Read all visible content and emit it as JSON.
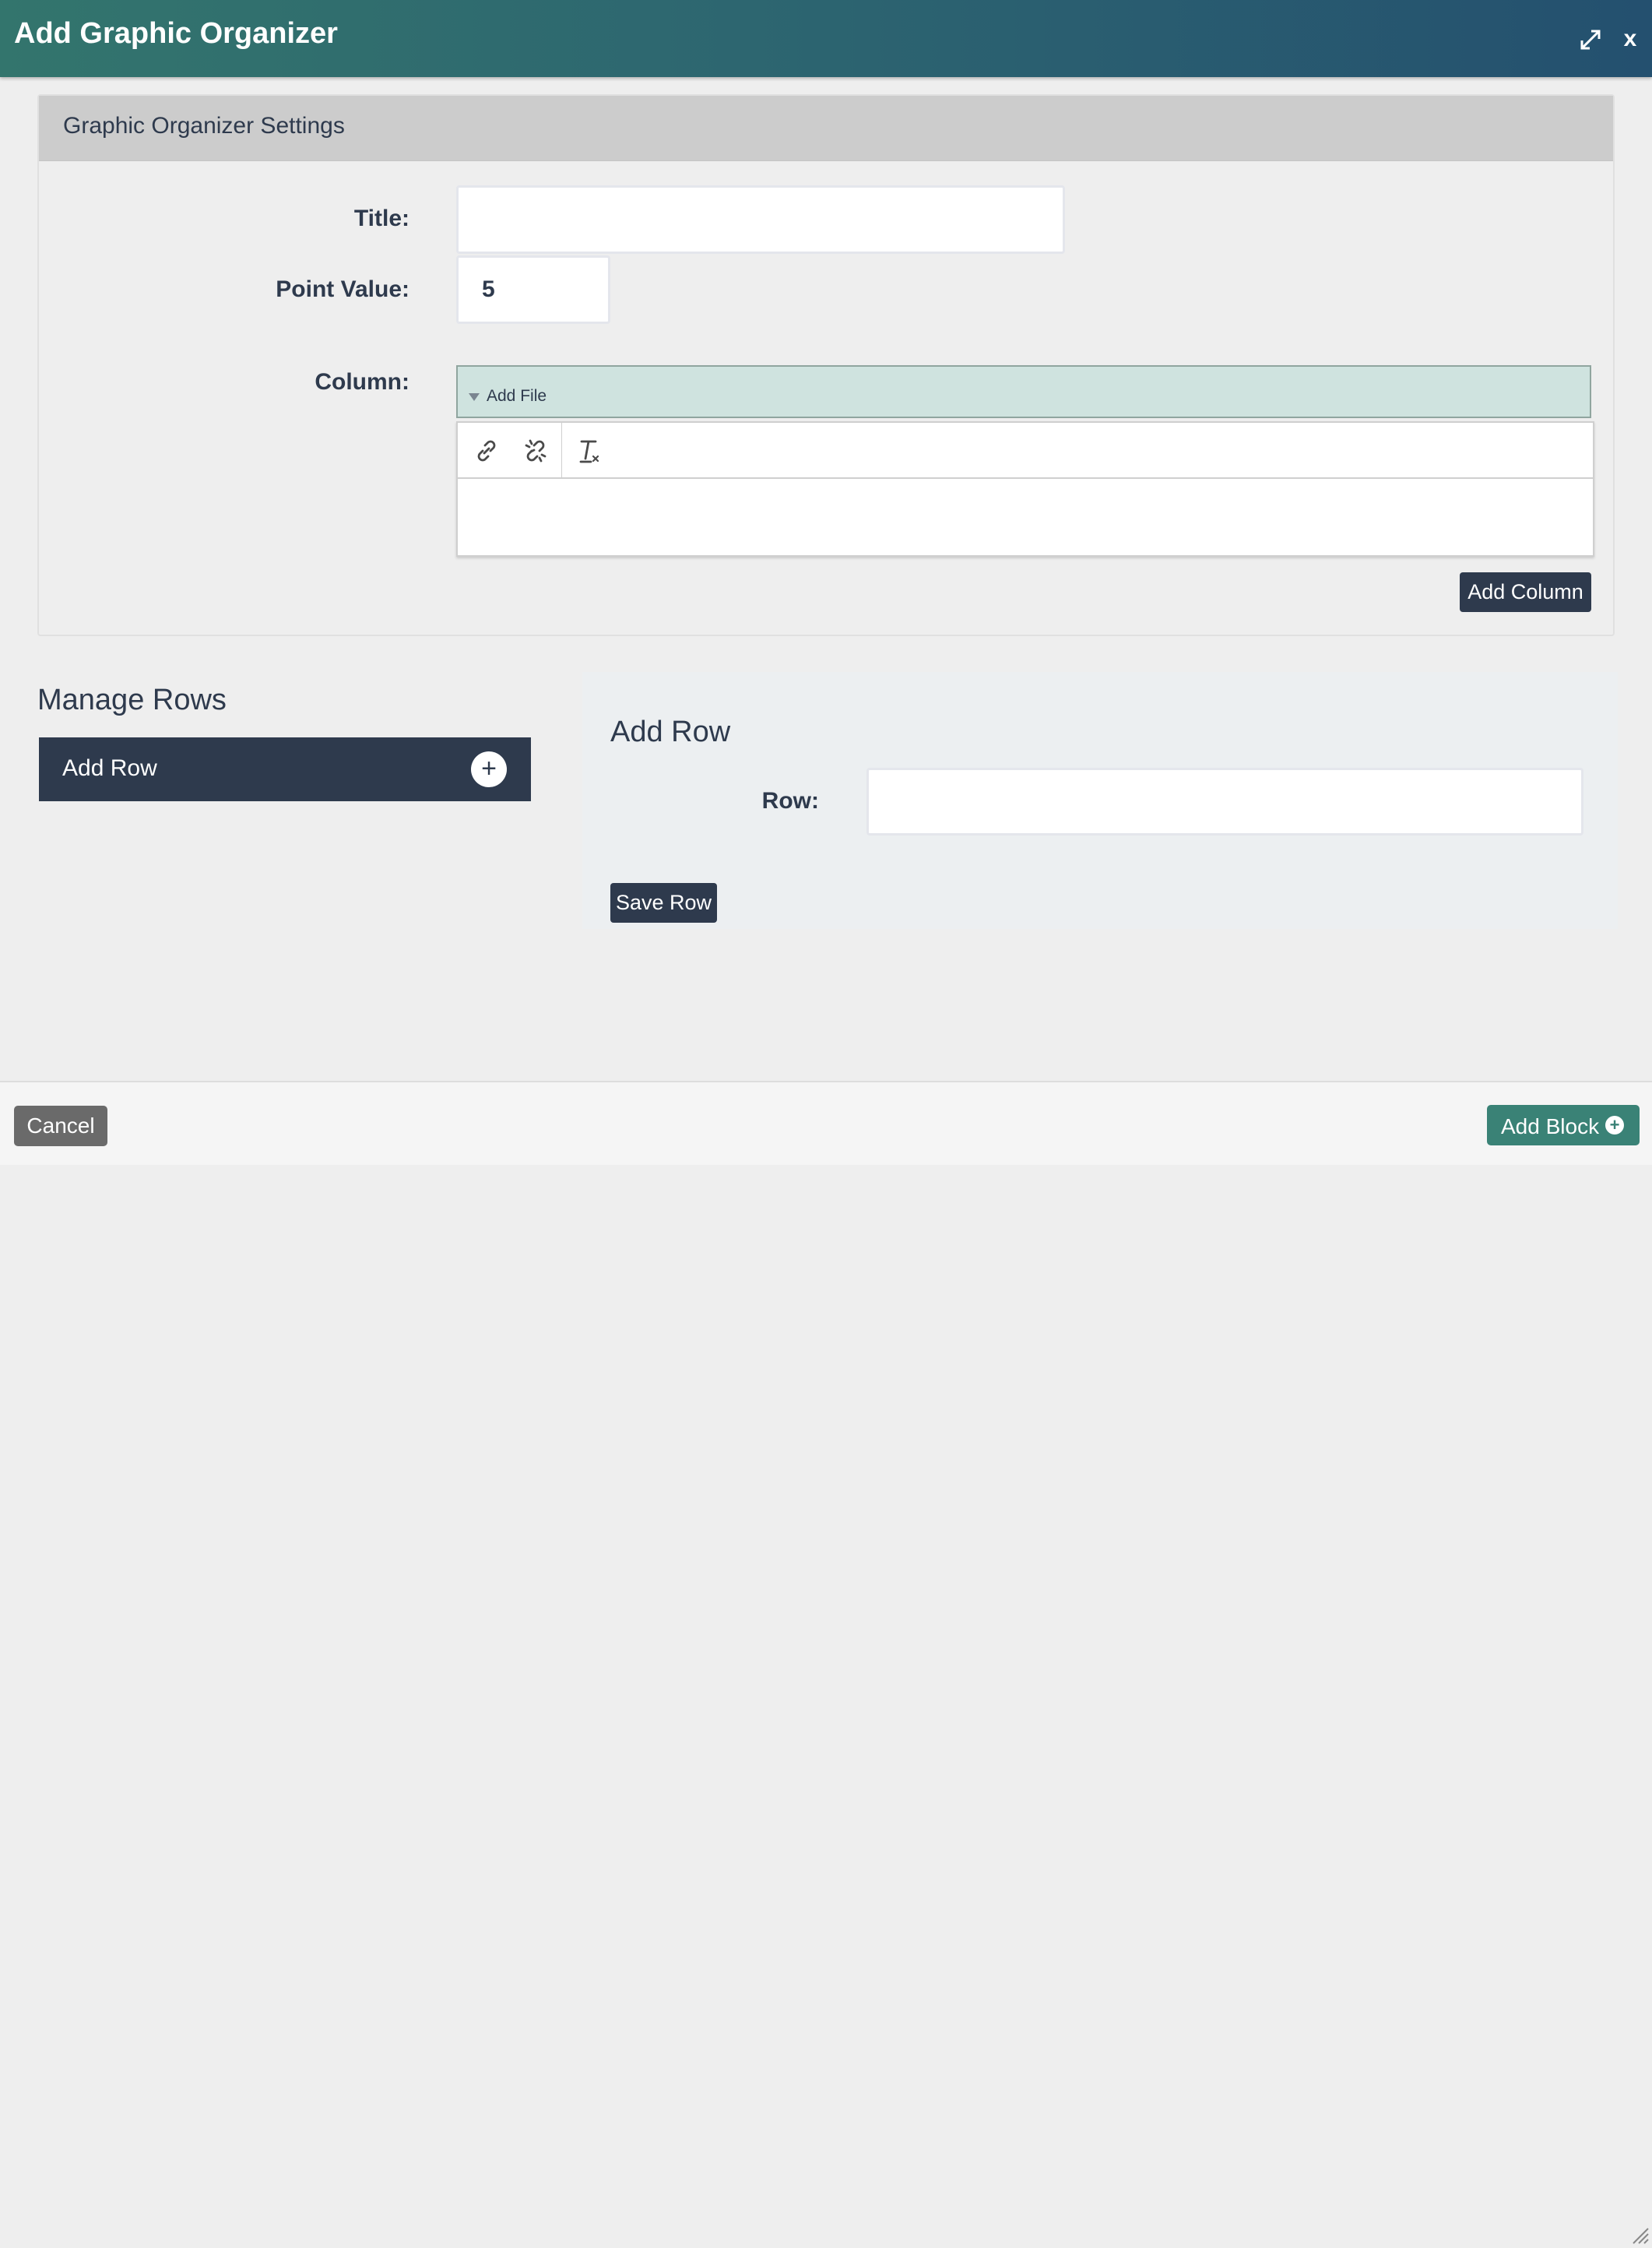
{
  "dialog": {
    "title": "Add Graphic Organizer",
    "expand_icon": "expand-icon",
    "close_label": "x"
  },
  "settings": {
    "heading": "Graphic Organizer Settings",
    "title_label": "Title:",
    "title_value": "",
    "point_value_label": "Point Value:",
    "point_value": "5",
    "column_label": "Column:",
    "add_file_label": "Add File",
    "toolbar_icons": [
      "link-icon",
      "unlink-icon",
      "remove-format-icon"
    ],
    "add_column_label": "Add Column"
  },
  "manage_rows": {
    "heading": "Manage Rows",
    "add_row_item_label": "Add Row",
    "plus_icon": "+"
  },
  "add_row_panel": {
    "heading": "Add Row",
    "row_label": "Row:",
    "row_value": "",
    "save_label": "Save Row"
  },
  "footer": {
    "cancel_label": "Cancel",
    "add_block_label": "Add Block",
    "add_block_icon": "+"
  },
  "colors": {
    "header_start": "#33756d",
    "header_end": "#24506f",
    "dark_button": "#2e3a4d",
    "add_file_bg": "#cfe3df",
    "add_block_bg": "#3a8276",
    "cancel_bg": "#6a6a6a"
  }
}
